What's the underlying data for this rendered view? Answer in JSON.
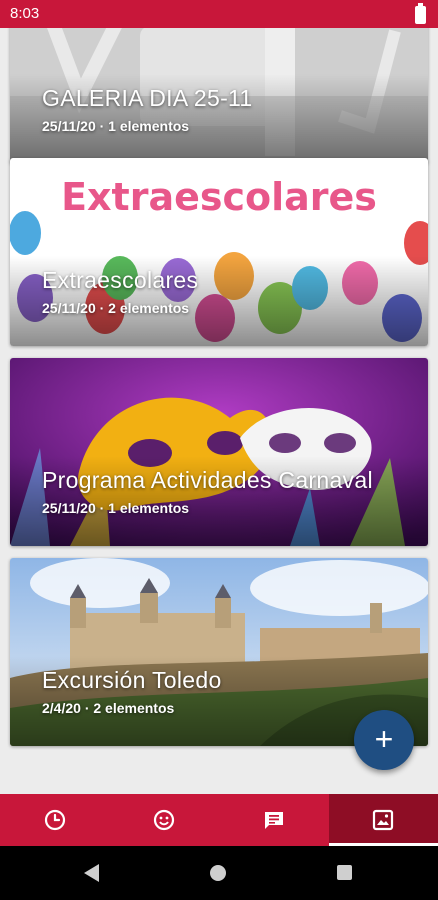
{
  "status_bar": {
    "time": "8:03"
  },
  "albums": [
    {
      "title": "GALERIA DIA 25-11",
      "meta": "25/11/20 · 1 elementos"
    },
    {
      "title": "Extraescolares",
      "meta": "25/11/20 · 2 elementos",
      "image_text": "Extraescolares"
    },
    {
      "title": "Programa Actividades Carnaval",
      "meta": "25/11/20 · 1 elementos"
    },
    {
      "title": "Excursión Toledo",
      "meta": "2/4/20 · 2 elementos"
    }
  ],
  "fab": {
    "icon": "plus-icon",
    "label": "+"
  },
  "bottom_nav": {
    "items": [
      {
        "icon": "clock-icon"
      },
      {
        "icon": "smiley-icon"
      },
      {
        "icon": "message-icon"
      },
      {
        "icon": "gallery-icon",
        "active": true
      }
    ]
  },
  "colors": {
    "primary": "#c8173a",
    "primary_dark": "#8e0d25",
    "fab": "#1f4e82"
  }
}
